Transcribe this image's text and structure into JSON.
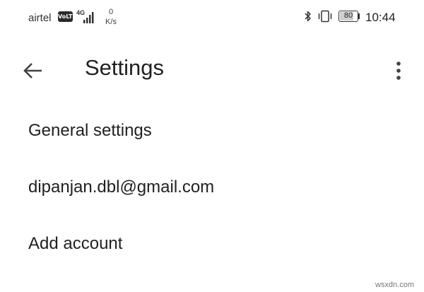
{
  "status_bar": {
    "carrier": "airtel",
    "volte": "VoLTE",
    "network_type": "4G",
    "speed_value": "0",
    "speed_unit": "K/s",
    "battery_level": "80",
    "time": "10:44"
  },
  "app_bar": {
    "back_icon": "arrow-back-icon",
    "title": "Settings",
    "more_icon": "more-vert-icon"
  },
  "settings": {
    "items": [
      {
        "label": "General settings"
      },
      {
        "label": "dipanjan.dbl@gmail.com"
      },
      {
        "label": "Add account"
      }
    ]
  },
  "watermark": "wsxdn.com"
}
